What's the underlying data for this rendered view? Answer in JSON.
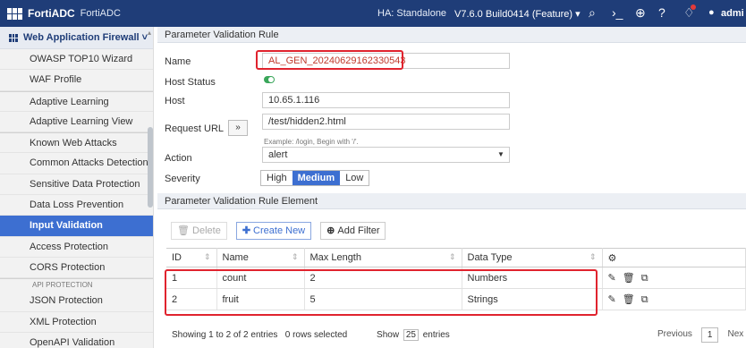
{
  "topbar": {
    "brand": "FortiADC",
    "brand_sub": "FortiADC",
    "ha": "HA: Standalone",
    "version": "V7.6.0 Build0414 (Feature)",
    "user": "admi"
  },
  "sidebar": {
    "header": "Web Application Firewall",
    "items": [
      {
        "label": "OWASP TOP10 Wizard"
      },
      {
        "label": "WAF Profile"
      },
      {
        "label": "Adaptive Learning"
      },
      {
        "label": "Adaptive Learning View"
      },
      {
        "label": "Known Web Attacks"
      },
      {
        "label": "Common Attacks Detection"
      },
      {
        "label": "Sensitive Data Protection"
      },
      {
        "label": "Data Loss Prevention"
      },
      {
        "label": "Input Validation"
      },
      {
        "label": "Access Protection"
      },
      {
        "label": "CORS Protection"
      },
      {
        "label": "API PROTECTION"
      },
      {
        "label": "JSON Protection"
      },
      {
        "label": "XML Protection"
      },
      {
        "label": "OpenAPI Validation"
      }
    ]
  },
  "rule": {
    "section_title": "Parameter Validation Rule",
    "name_label": "Name",
    "name_value": "AL_GEN_20240629162330543",
    "host_status_label": "Host Status",
    "host_label": "Host",
    "host_value": "10.65.1.116",
    "request_url_label": "Request URL",
    "request_url_btn": "»",
    "request_url_value": "/test/hidden2.html",
    "request_url_hint": "Example: /login, Begin with '/'.",
    "action_label": "Action",
    "action_value": "alert",
    "severity_label": "Severity",
    "severity": {
      "high": "High",
      "medium": "Medium",
      "low": "Low",
      "selected": "Medium"
    }
  },
  "elements": {
    "section_title": "Parameter Validation Rule Element",
    "delete_label": "Delete",
    "create_label": "Create New",
    "filter_label": "Add Filter",
    "columns": {
      "id": "ID",
      "name": "Name",
      "max_length": "Max Length",
      "data_type": "Data Type"
    },
    "rows": [
      {
        "id": "1",
        "name": "count",
        "max_length": "2",
        "data_type": "Numbers"
      },
      {
        "id": "2",
        "name": "fruit",
        "max_length": "5",
        "data_type": "Strings"
      }
    ]
  },
  "footer": {
    "summary": "Showing 1 to 2 of 2 entries",
    "selected": "0 rows selected",
    "show_label": "Show",
    "show_value": "25",
    "entries_label": "entries",
    "previous": "Previous",
    "page": "1",
    "next": "Nex"
  },
  "colors": {
    "topbar": "#1f3d78",
    "active": "#3d6fd1",
    "highlight": "#e0232e"
  }
}
